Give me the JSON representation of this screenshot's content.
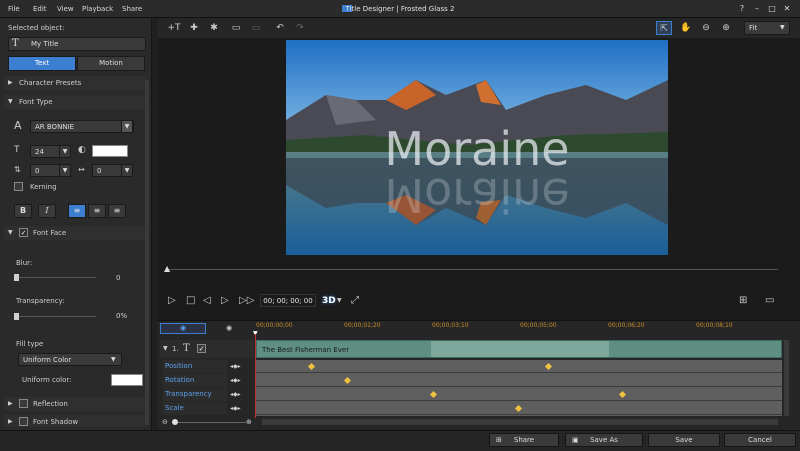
{
  "menu": {
    "file": "File",
    "edit": "Edit",
    "view": "View",
    "playback": "Playback",
    "share": "Share"
  },
  "window": {
    "title": "Title Designer | Frosted Glass 2",
    "minimize": "–",
    "restore": "□",
    "close": "✕",
    "help": "?"
  },
  "left": {
    "selected_object_label": "Selected object:",
    "selected_object_value": "My Title",
    "tab_text": "Text",
    "tab_motion": "Motion",
    "character_presets": "Character Presets",
    "font_type": "Font Type",
    "font_name": "AR BONNIE",
    "font_size": "24",
    "line_spacing": "0",
    "char_spacing": "0",
    "kerning": "Kerning",
    "font_face": "Font Face",
    "blur_label": "Blur:",
    "blur_value": "0",
    "transparency_label": "Transparency:",
    "transparency_value": "0%",
    "fill_type_label": "Fill type",
    "fill_type_value": "Uniform Color",
    "uniform_color_label": "Uniform color:",
    "reflection": "Reflection",
    "font_shadow": "Font Shadow"
  },
  "toolbar": {
    "fit": "Fit"
  },
  "preview": {
    "title_text": "Moraine"
  },
  "playback": {
    "timecode": "00; 00; 00; 00",
    "mode_3d": "3D"
  },
  "timeline": {
    "ticks": [
      "00;00;00;00",
      "00;00;01;20",
      "00;00;03;10",
      "00;00;05;00",
      "00;00;06;20",
      "00;00;08;10"
    ],
    "track_number": "1.",
    "clip_label": "The Best Fisherman Ever",
    "rows": [
      "Position",
      "Rotation",
      "Transparency",
      "Scale"
    ]
  },
  "bottom": {
    "share": "Share",
    "save_as": "Save As",
    "save": "Save",
    "cancel": "Cancel"
  },
  "colors": {
    "accent": "#3c7fd0",
    "keyframe": "#f0c040",
    "track_label": "#5aa0e8",
    "clip": "#5f8f82"
  }
}
